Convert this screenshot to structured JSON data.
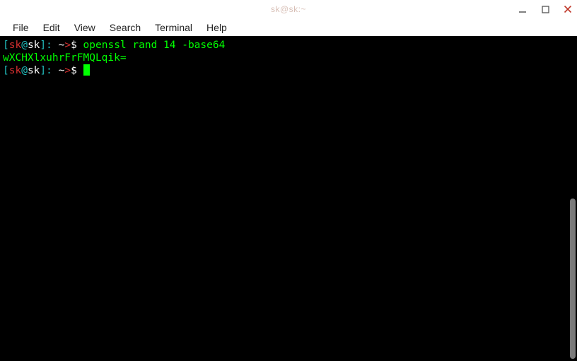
{
  "window": {
    "title": "sk@sk:~"
  },
  "menu": {
    "file": "File",
    "edit": "Edit",
    "view": "View",
    "search": "Search",
    "terminal": "Terminal",
    "help": "Help"
  },
  "prompt": {
    "open": "[",
    "user": "sk",
    "at": "@",
    "host": "sk",
    "close": "]: ",
    "path": "~",
    "arrow": ">",
    "dollar": "$ "
  },
  "terminal": {
    "command1": "openssl rand 14 -base64",
    "output1": "wXCHXlxuhrFrFMQLqik="
  }
}
